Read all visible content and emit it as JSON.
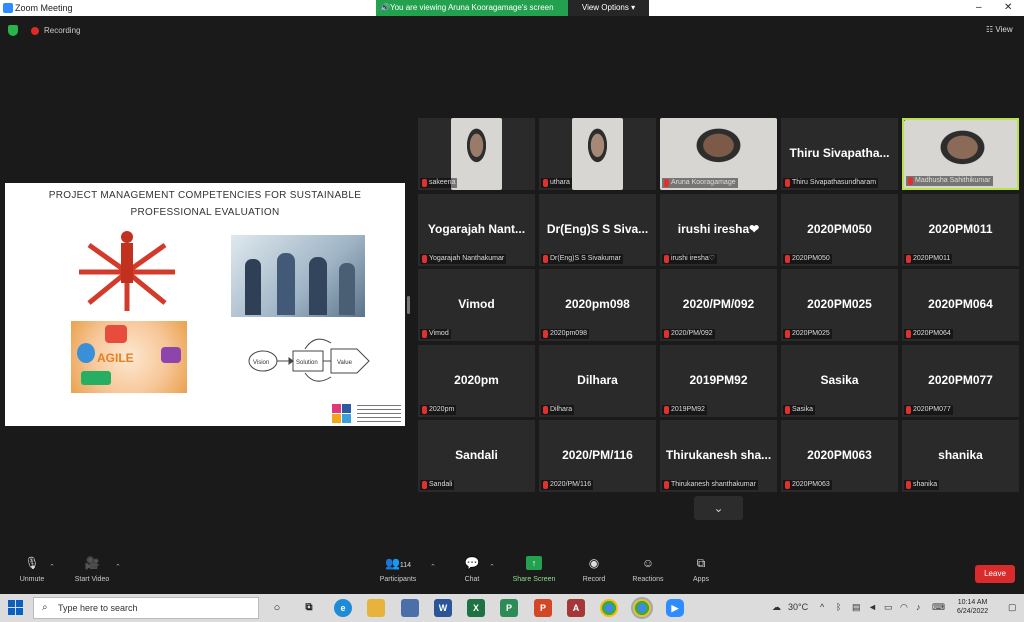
{
  "window": {
    "title": "Zoom Meeting"
  },
  "share_banner": {
    "text": "You are viewing Aruna Kooragamage's screen",
    "view_options": "View Options"
  },
  "recording": {
    "label": "Recording"
  },
  "view_button": {
    "label": "View"
  },
  "slide": {
    "title_line1": "PROJECT MANAGEMENT COMPETENCIES FOR SUSTAINABLE",
    "title_line2": "PROFESSIONAL EVALUATION",
    "agile_word": "AGILE",
    "flow_labels": [
      "Vision",
      "Solution",
      "Value"
    ]
  },
  "participants": [
    {
      "name": "",
      "label": "sakeena",
      "video": true
    },
    {
      "name": "",
      "label": "uthara",
      "video": true
    },
    {
      "name": "",
      "label": "Aruna Kooragamage",
      "video": true
    },
    {
      "name": "Thiru Sivapatha...",
      "label": "Thiru Sivapathasundharam",
      "video": false
    },
    {
      "name": "",
      "label": "Madhusha Sahithikumar",
      "video": true,
      "active": true
    },
    {
      "name": "Yogarajah Nant...",
      "label": "Yogarajah Nanthakumar",
      "video": false
    },
    {
      "name": "Dr(Eng)S S Siva...",
      "label": "Dr(Eng)S S Sivakumar",
      "video": false
    },
    {
      "name": "irushi iresha❤",
      "label": "irushi iresha♡",
      "video": false
    },
    {
      "name": "2020PM050",
      "label": "2020PM050",
      "video": false
    },
    {
      "name": "2020PM011",
      "label": "2020PM011",
      "video": false
    },
    {
      "name": "Vimod",
      "label": "Vimod",
      "video": false
    },
    {
      "name": "2020pm098",
      "label": "2020pm098",
      "video": false
    },
    {
      "name": "2020/PM/092",
      "label": "2020/PM/092",
      "video": false
    },
    {
      "name": "2020PM025",
      "label": "2020PM025",
      "video": false
    },
    {
      "name": "2020PM064",
      "label": "2020PM064",
      "video": false
    },
    {
      "name": "2020pm",
      "label": "2020pm",
      "video": false
    },
    {
      "name": "Dilhara",
      "label": "Dilhara",
      "video": false
    },
    {
      "name": "2019PM92",
      "label": "2019PM92",
      "video": false
    },
    {
      "name": "Sasika",
      "label": "Sasika",
      "video": false
    },
    {
      "name": "2020PM077",
      "label": "2020PM077",
      "video": false
    },
    {
      "name": "Sandali",
      "label": "Sandali",
      "video": false
    },
    {
      "name": "2020/PM/116",
      "label": "2020/PM/116",
      "video": false
    },
    {
      "name": "Thirukanesh sha...",
      "label": "Thirukanesh shanthakumar",
      "video": false
    },
    {
      "name": "2020PM063",
      "label": "2020PM063",
      "video": false
    },
    {
      "name": "shanika",
      "label": "shanika",
      "video": false
    }
  ],
  "toolbar": {
    "unmute": "Unmute",
    "start_video": "Start Video",
    "participants": "Participants",
    "participant_count": "114",
    "chat": "Chat",
    "share_screen": "Share Screen",
    "record": "Record",
    "reactions": "Reactions",
    "apps": "Apps",
    "leave": "Leave"
  },
  "taskbar": {
    "search_placeholder": "Type here to search",
    "temperature": "30°C",
    "time": "10:14 AM",
    "date": "6/24/2022"
  },
  "colors": {
    "share_green": "#23a14e",
    "leave_red": "#d92b2b",
    "active_border": "#b8e34a"
  }
}
